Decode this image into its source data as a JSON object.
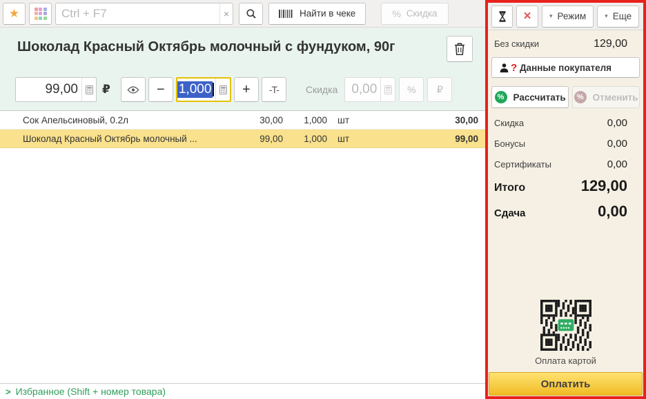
{
  "toolbar": {
    "star_icon": "★",
    "search_placeholder": "Ctrl + F7",
    "clear_button": "×",
    "find_in_receipt_label": "Найти в чеке",
    "discount_percent_icon": "%",
    "discount_button_label": "Скидка"
  },
  "product": {
    "title": "Шоколад Красный Октябрь молочный с фундуком, 90г",
    "price_value": "99,00",
    "currency_symbol": "₽",
    "minus_label": "−",
    "quantity_value": "1,000",
    "plus_label": "+",
    "text_button_label": "-T-",
    "discount_label": "Скидка",
    "discount_value": "0,00",
    "percent_label": "%",
    "ruble_label": "₽"
  },
  "items": [
    {
      "name": "Сок Апельсиновый, 0.2л",
      "price": "30,00",
      "qty": "1,000",
      "unit": "шт",
      "total": "30,00"
    },
    {
      "name": "Шоколад Красный Октябрь молочный ...",
      "price": "99,00",
      "qty": "1,000",
      "unit": "шт",
      "total": "99,00"
    }
  ],
  "footer": {
    "chevron": ">",
    "favorites_label": "Избранное (Shift + номер товара)"
  },
  "panel": {
    "close_icon": "×",
    "dropdown_arrow": "▾",
    "mode_label": "Режим",
    "more_label": "Еще",
    "no_discount_label": "Без скидки",
    "no_discount_value": "129,00",
    "customer_warning": "?",
    "customer_button_label": "Данные покупателя",
    "percent_icon": "%",
    "calculate_label": "Рассчитать",
    "cancel_label": "Отменить",
    "summary": [
      {
        "label": "Скидка",
        "value": "0,00"
      },
      {
        "label": "Бонусы",
        "value": "0,00"
      },
      {
        "label": "Сертификаты",
        "value": "0,00"
      }
    ],
    "total_label": "Итого",
    "total_value": "129,00",
    "change_label": "Сдача",
    "change_value": "0,00",
    "card_payment_label": "Оплата картой",
    "pay_button_label": "Оплатить"
  },
  "colors": {
    "panel_border": "#e8211d",
    "selected_row": "#f9e18d",
    "selection_blue": "#3c62c8",
    "quantity_focus_border": "#e5c100",
    "accent_green_link": "#2e9e5b",
    "percent_badge_green": "#1fa85a",
    "pay_button_yellow": "#f0bb25",
    "header_mint": "#e9f4ee"
  }
}
